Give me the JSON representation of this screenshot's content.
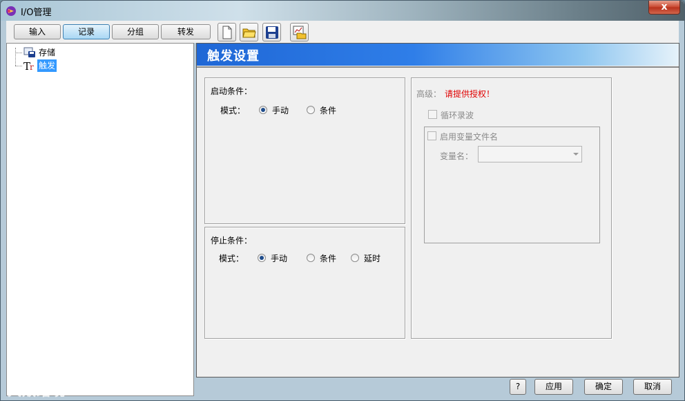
{
  "window": {
    "title": "I/O管理",
    "close_label": "x"
  },
  "toolbar": {
    "tabs": [
      {
        "label": "输入",
        "active": false
      },
      {
        "label": "记录",
        "active": true
      },
      {
        "label": "分组",
        "active": false
      },
      {
        "label": "转发",
        "active": false
      }
    ],
    "icons": [
      "new-file-icon",
      "open-folder-icon",
      "save-disk-icon",
      "import-chart-icon"
    ]
  },
  "tree": {
    "items": [
      {
        "label": "存储",
        "icon": "storage-disk-icon",
        "selected": false
      },
      {
        "label": "触发",
        "icon": "trigger-tr-icon",
        "selected": true
      }
    ]
  },
  "panel": {
    "title": "触发设置",
    "start": {
      "title": "启动条件：",
      "mode_label": "模式：",
      "options": [
        "手动",
        "条件"
      ],
      "selected": "手动"
    },
    "stop": {
      "title": "停止条件：",
      "mode_label": "模式：",
      "options": [
        "手动",
        "条件",
        "延时"
      ],
      "selected": "手动"
    },
    "advanced": {
      "label": "高级：",
      "warning": "请提供授权！",
      "loop_label": "循环录波",
      "varfile_label": "启用变量文件名",
      "varname_label": "变量名："
    }
  },
  "footer": {
    "help": "?",
    "apply": "应用",
    "ok": "确定",
    "cancel": "取消"
  },
  "watermark": "大败踏境"
}
